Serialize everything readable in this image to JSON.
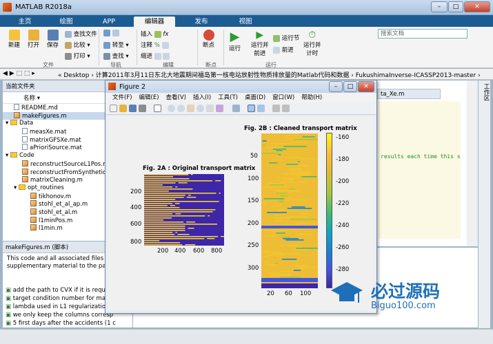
{
  "window": {
    "title": "MATLAB R2018a",
    "min": "–",
    "max": "□",
    "close": "✕"
  },
  "tabs": [
    "主页",
    "绘图",
    "APP",
    "编辑器",
    "发布",
    "视图"
  ],
  "search": {
    "placeholder": "搜索文档"
  },
  "ribbon": {
    "new": "新建",
    "open": "打开",
    "save": "保存",
    "find_files": "查找文件",
    "compare": "比较",
    "print": "打印",
    "goto": "转至",
    "find": "查找",
    "insert": "插入",
    "fx": "fx",
    "comment": "注释",
    "indent": "缩进",
    "breakpoints": "断点",
    "run": "运行",
    "run_advance": "运行并\n前进",
    "run_section": "运行节",
    "advance": "前进",
    "run_time": "运行并\n计时",
    "groups": {
      "file": "文件",
      "navigate": "导航",
      "edit": "编辑",
      "breakpoints": "断点",
      "run": "运行"
    }
  },
  "address": {
    "path": "« Desktop › 计算2011年3月11日东北大地震期间福岛第一核电站放射性物质排放量的Matlab代码和数据 › FukushimaInverse-ICASSP2013-master ›"
  },
  "folder": {
    "title": "当前文件夹",
    "column": "名称 ▾",
    "items": [
      {
        "n": "README.md",
        "t": "file",
        "d": 1
      },
      {
        "n": "makeFigures.m",
        "t": "m",
        "d": 1,
        "sel": true
      },
      {
        "n": "Data",
        "t": "folder",
        "d": 0
      },
      {
        "n": "measXe.mat",
        "t": "mat",
        "d": 2
      },
      {
        "n": "matrixGFSXe.mat",
        "t": "mat",
        "d": 2
      },
      {
        "n": "aPrioriSource.mat",
        "t": "mat",
        "d": 2
      },
      {
        "n": "Code",
        "t": "folder",
        "d": 0
      },
      {
        "n": "reconstructSourceL1Pos.m",
        "t": "m",
        "d": 2
      },
      {
        "n": "reconstructFromSyntheticD",
        "t": "m",
        "d": 2
      },
      {
        "n": "matrixCleaning.m",
        "t": "m",
        "d": 2
      },
      {
        "n": "opt_routines",
        "t": "folder",
        "d": 1
      },
      {
        "n": "tikhonov.m",
        "t": "m",
        "d": 3
      },
      {
        "n": "stohl_et_al_ap.m",
        "t": "m",
        "d": 3
      },
      {
        "n": "stohl_et_al.m",
        "t": "m",
        "d": 3
      },
      {
        "n": "l1minPos.m",
        "t": "m",
        "d": 3
      },
      {
        "n": "l1min.m",
        "t": "m",
        "d": 3
      }
    ]
  },
  "details": {
    "title": "makeFigures.m  (脚本)",
    "desc": "This code and all associated files a the supplementary material to the paper",
    "lines": [
      "add the path to CVX if it is requ",
      "target condition number for ma",
      "lambda used in L1 regularizatio",
      "we only keep the columns corresp",
      "5 first days after the accidents (1 c"
    ]
  },
  "editor": {
    "tab": "ta_Xe.m",
    "code": "results each time this s",
    "side_label": "工作区"
  },
  "figure": {
    "title": "Figure 2",
    "menu": [
      "文件(F)",
      "编辑(E)",
      "查看(V)",
      "插入(I)",
      "工具(T)",
      "桌面(D)",
      "窗口(W)",
      "帮助(H)"
    ],
    "ax1_title": "Fig. 2A : Original transport matrix",
    "ax1_yticks": [
      "200",
      "400",
      "600",
      "800"
    ],
    "ax1_xticks": [
      "200",
      "400",
      "600",
      "800"
    ],
    "ax2_title": "Fig. 2B : Cleaned transport matrix",
    "ax2_yticks": [
      "50",
      "100",
      "150",
      "200",
      "250",
      "300"
    ],
    "ax2_xticks": [
      "20",
      "60",
      "100"
    ],
    "cbar_ticks": [
      "-160",
      "-180",
      "-200",
      "-220",
      "-240",
      "-260",
      "-280"
    ]
  },
  "watermark": {
    "cn": "必过源码",
    "url": "Biguo100.com"
  },
  "colors": {
    "ribbon_blue": "#1d5c93",
    "parula_yellow": "#f9e721",
    "parula_blue": "#3e26a8"
  }
}
